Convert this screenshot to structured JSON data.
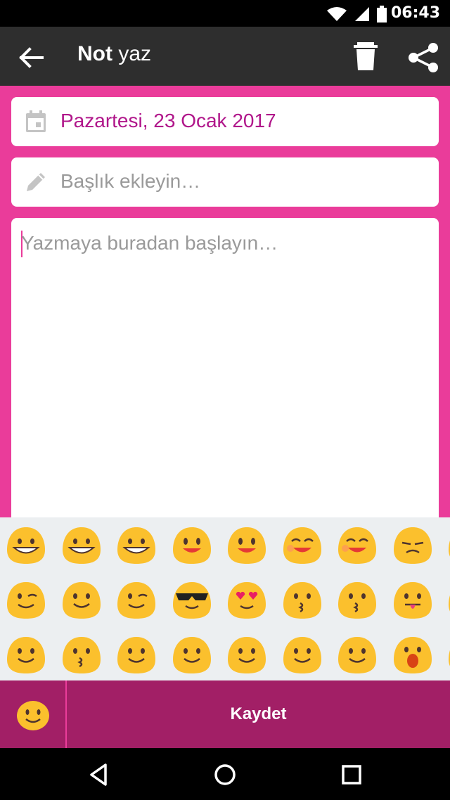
{
  "status": {
    "time": "06:43"
  },
  "appbar": {
    "title_bold": "Not",
    "title_rest": " yaz"
  },
  "date_field": {
    "value": "Pazartesi, 23 Ocak 2017"
  },
  "title_field": {
    "placeholder": "Başlık ekleyin…"
  },
  "body_field": {
    "placeholder": "Yazmaya buradan başlayın…"
  },
  "emoji_panel": {
    "emoji_icons": [
      "grinning",
      "grinning-wide",
      "laughing-tears",
      "smile",
      "smile-open",
      "sweat-smile",
      "squint-laugh",
      "pensive",
      "wink",
      "blush",
      "tongue-wink",
      "sunglasses",
      "heart-eyes",
      "kiss-heart",
      "kissing",
      "tongue",
      "relieved",
      "kissing-closed-eyes",
      "slight-smile",
      "smile-plain",
      "sleepy",
      "angel",
      "turban",
      "screaming"
    ]
  },
  "bottom": {
    "save_label": "Kaydet"
  },
  "colors": {
    "accent": "#ea3c9a",
    "bottom_bar": "#a21f66",
    "date_text": "#b0168a",
    "appbar": "#2e2e2e"
  }
}
